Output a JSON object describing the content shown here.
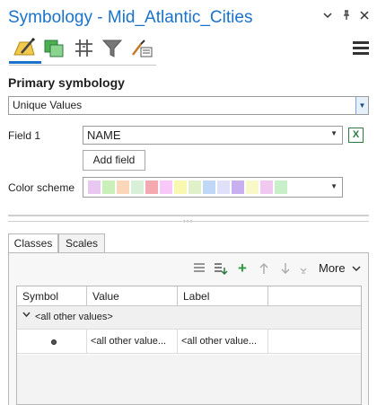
{
  "window": {
    "title": "Symbology - Mid_Atlantic_Cities",
    "controls": [
      "chevron-down-icon",
      "pin-icon",
      "close-icon"
    ]
  },
  "toolbar": {
    "tools": [
      "primary-symbology-icon",
      "vary-symbology-icon",
      "label-classes-icon",
      "filter-icon",
      "symbol-properties-icon"
    ],
    "menu_icon": "hamburger-menu-icon"
  },
  "primary": {
    "heading": "Primary symbology",
    "method": "Unique Values"
  },
  "field1": {
    "label": "Field 1",
    "value": "NAME",
    "expression_icon": "excel-expression-icon"
  },
  "add_field": {
    "label": "Add field"
  },
  "color_scheme": {
    "label": "Color scheme",
    "colors": [
      "#e8c8f0",
      "#c8f0b8",
      "#fcd6b8",
      "#d8f0d8",
      "#f4a8b0",
      "#f8c8f8",
      "#f8f8b0",
      "#e0f0c8",
      "#c0d8f8",
      "#e0e0f8",
      "#c8b0f0",
      "#f8f8c8",
      "#f0c8f0",
      "#c8f0c8"
    ]
  },
  "tabs": [
    {
      "label": "Classes",
      "active": true
    },
    {
      "label": "Scales",
      "active": false
    }
  ],
  "classes_toolbar": {
    "icons": [
      "list-view-icon",
      "add-values-icon",
      "add-icon",
      "move-up-icon",
      "move-down-icon",
      "chevron-more-icon"
    ],
    "more_label": "More"
  },
  "grid": {
    "columns": [
      "Symbol",
      "Value",
      "Label"
    ],
    "group": "<all other values>",
    "rows": [
      {
        "symbol": "point-symbol",
        "value": "<all other value...",
        "label": "<all other value..."
      }
    ]
  }
}
